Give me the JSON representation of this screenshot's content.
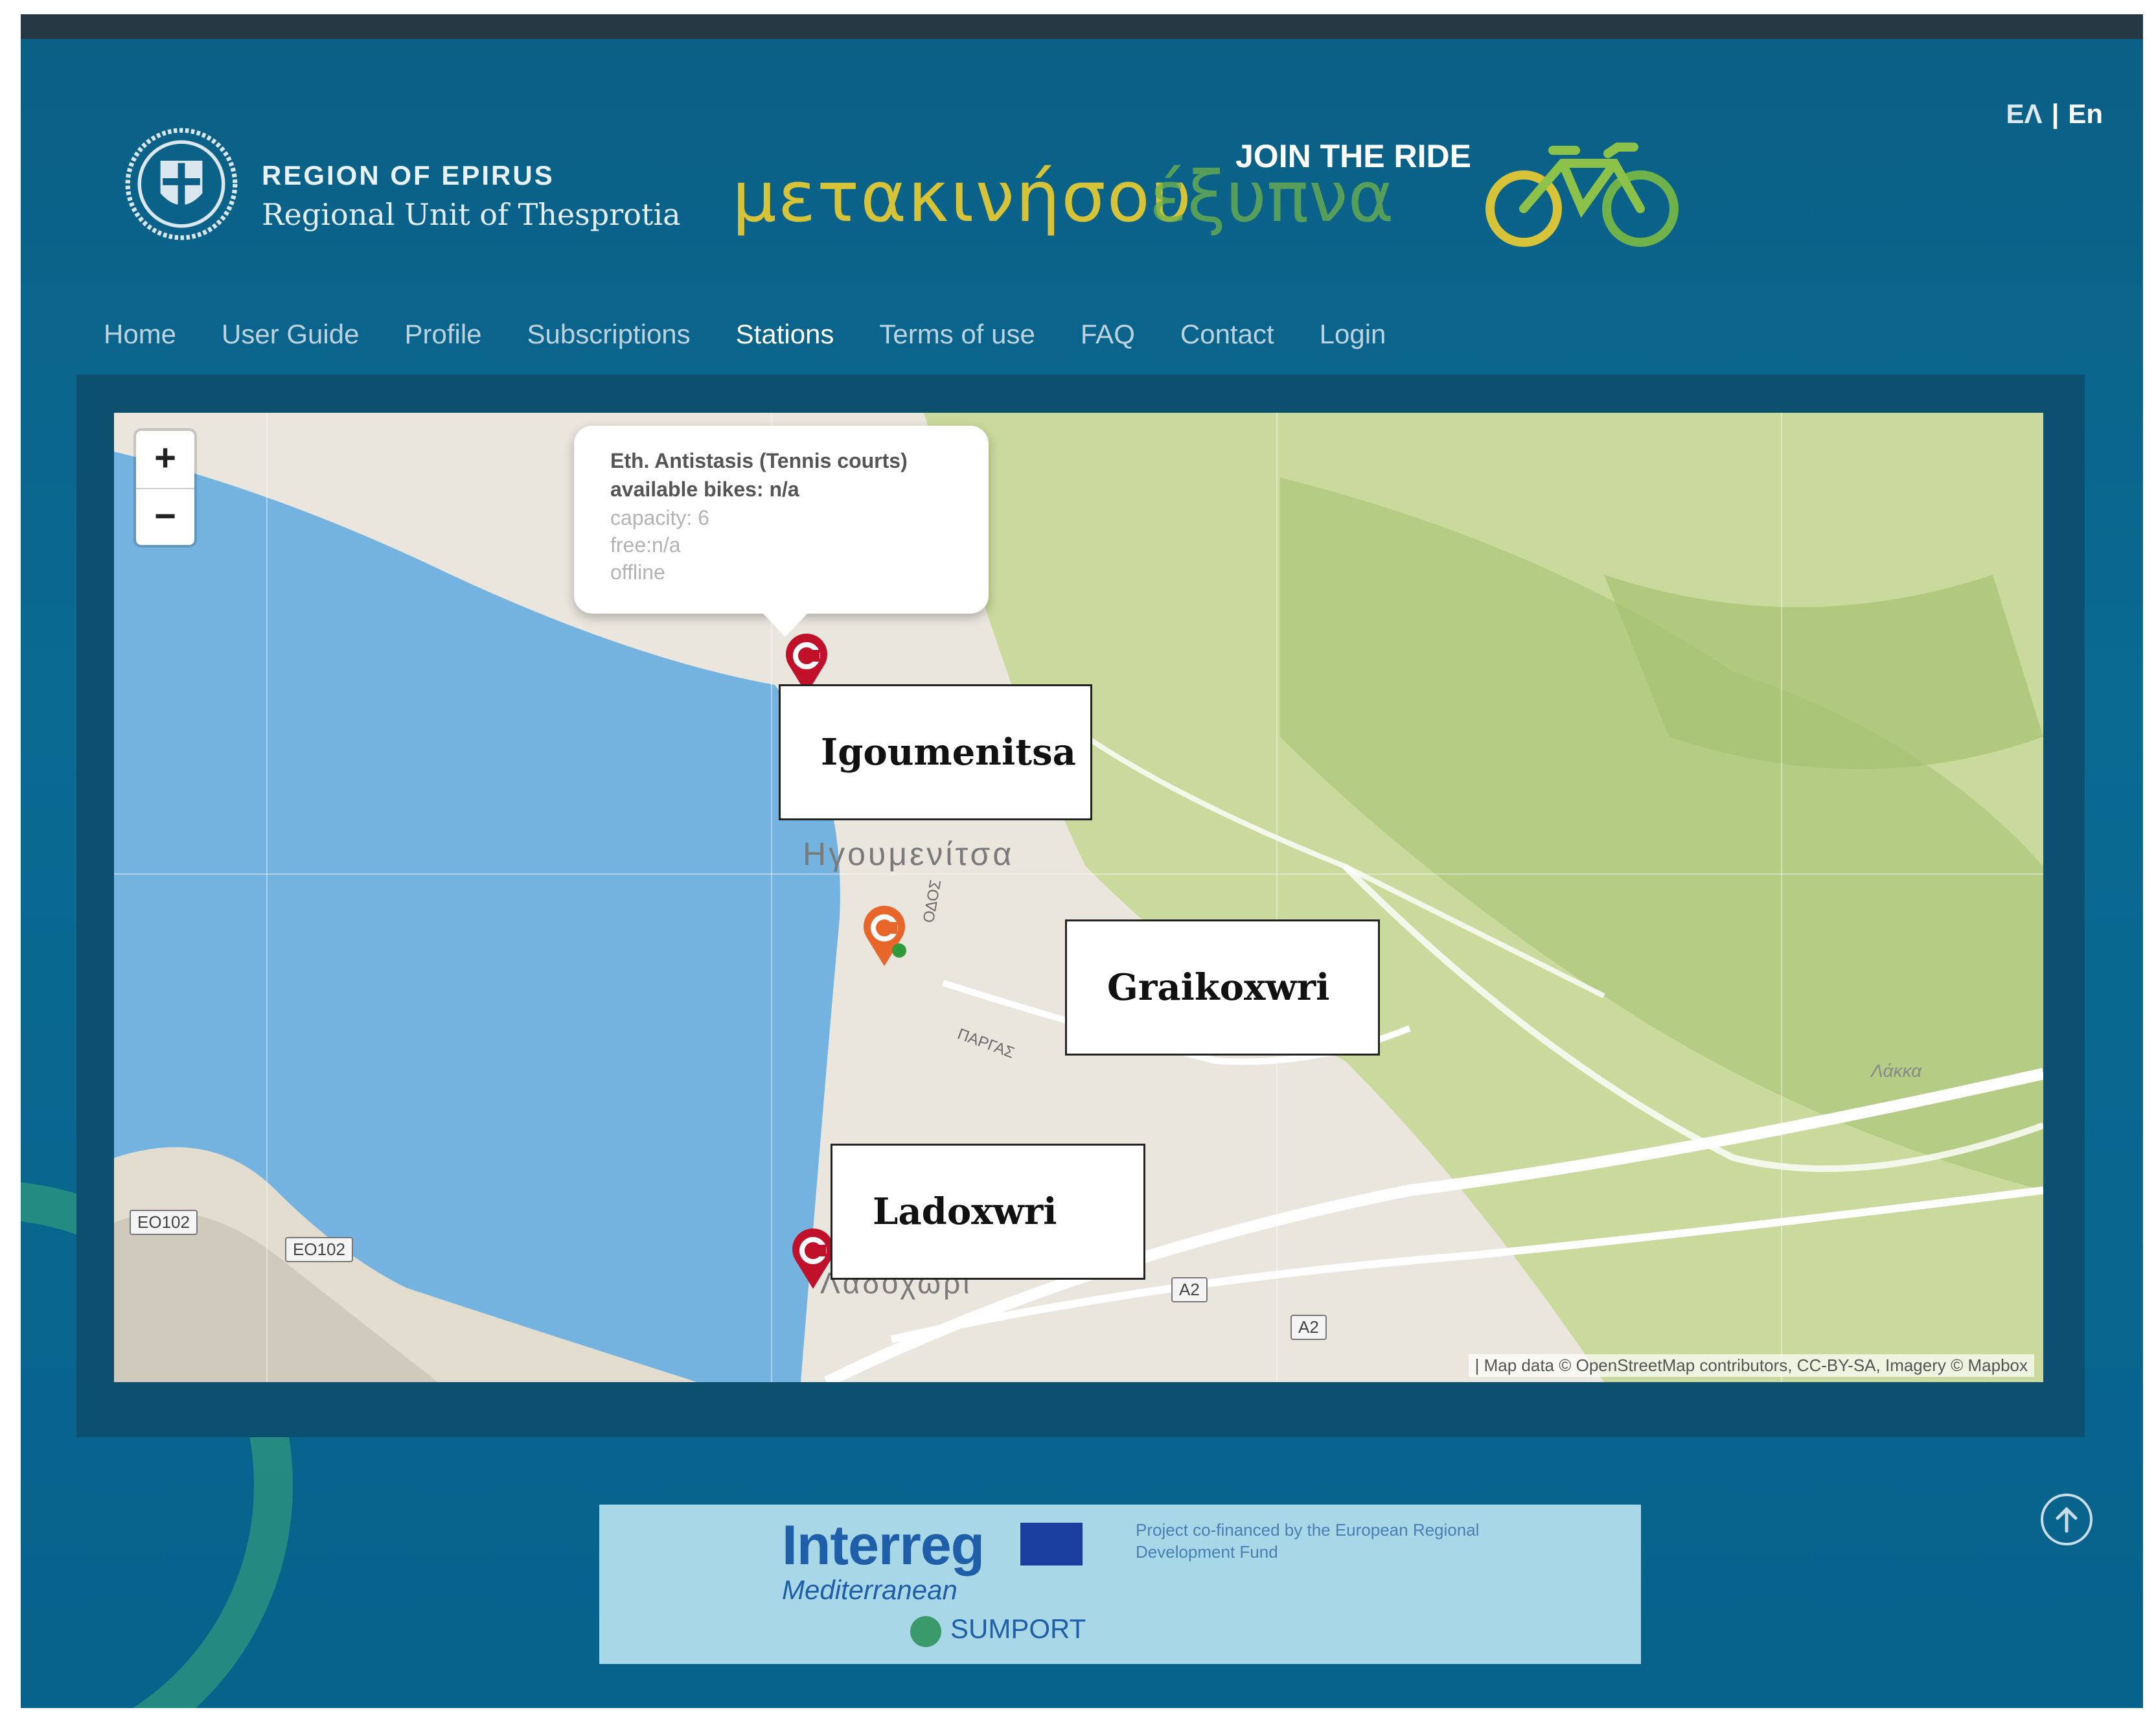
{
  "header": {
    "language_switch": {
      "greek": "ΕΛ",
      "separator": "|",
      "english": "En"
    },
    "region_title": "REGION OF EPIRUS",
    "region_subtitle": "Regional Unit of Thesprotia",
    "slogan_main": "μετακινήσου",
    "slogan_green": "έξυπνα",
    "join_text": "JOIN THE RIDE"
  },
  "nav": {
    "items": [
      {
        "label": "Home",
        "active": false
      },
      {
        "label": "User Guide",
        "active": false
      },
      {
        "label": "Profile",
        "active": false
      },
      {
        "label": "Subscriptions",
        "active": false
      },
      {
        "label": "Stations",
        "active": true
      },
      {
        "label": "Terms of use",
        "active": false
      },
      {
        "label": "FAQ",
        "active": false
      },
      {
        "label": "Contact",
        "active": false
      },
      {
        "label": "Login",
        "active": false
      }
    ]
  },
  "map": {
    "zoom_in": "+",
    "zoom_out": "−",
    "popup": {
      "name": "Eth. Antistasis (Tennis courts)",
      "available": "available bikes: n/a",
      "capacity": "capacity: 6",
      "free": "free:n/a",
      "status": "offline"
    },
    "city_label": "Ηγουμενίτσα",
    "area_label": "Λαδοχώρι",
    "street_parga": "ΠΑΡΓΑΣ",
    "street_side": "ΟΔΟΣ",
    "place_lakka": "Λάκκα",
    "roads": [
      "EO102",
      "EO102",
      "A2",
      "A2"
    ],
    "annotations": [
      "Igoumenitsa",
      "Graikoxwri",
      "Ladoxwri"
    ],
    "attribution": "| Map data © OpenStreetMap contributors, CC-BY-SA, Imagery © Mapbox",
    "colors": {
      "water": "#74b3e0",
      "land": "#eae6de",
      "forest": "#bdd38d",
      "marker_red": "#c0102a",
      "marker_orange": "#e8662a"
    }
  },
  "footer": {
    "interreg": "Interreg",
    "mediterranean": "Mediterranean",
    "cofinanced": "Project co-financed by the European Regional Development Fund",
    "sumport": "SUMPORT"
  },
  "icons": [
    "region-seal-icon",
    "bicycle-icon",
    "map-marker-icon",
    "scroll-to-top-icon",
    "eu-flag-icon"
  ]
}
